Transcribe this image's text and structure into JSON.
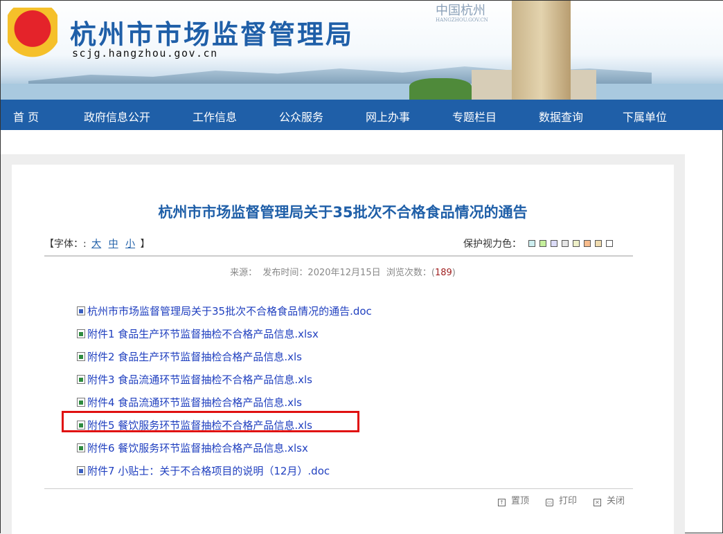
{
  "header": {
    "title": "杭州市市场监督管理局",
    "url": "scjg.hangzhou.gov.cn",
    "partner_logo": "中国杭州",
    "partner_url": "HANGZHOU.GOV.CN"
  },
  "nav": [
    "首 页",
    "政府信息公开",
    "工作信息",
    "公众服务",
    "网上办事",
    "专题栏目",
    "数据查询",
    "下属单位"
  ],
  "article": {
    "title": "杭州市市场监督管理局关于35批次不合格食品情况的通告",
    "font_label_open": "【字体：:",
    "font_sizes": [
      "大",
      "中",
      "小"
    ],
    "font_label_close": "】",
    "eye_label": "保护视力色：",
    "eye_colors": [
      "#cdeef0",
      "#c6f09c",
      "#dcdcf8",
      "#e6e6e6",
      "#eef0c8",
      "#f8bc8c",
      "#f0dcb0",
      "#ffffff"
    ],
    "meta_prefix": "来源：  发布时间：2020年12月15日  浏览次数：(",
    "views": "189",
    "meta_suffix": ")",
    "files": [
      {
        "name": "杭州市市场监督管理局关于35批次不合格食品情况的通告.doc",
        "type": "doc"
      },
      {
        "name": "附件1 食品生产环节监督抽检不合格产品信息.xlsx",
        "type": "xls"
      },
      {
        "name": "附件2 食品生产环节监督抽检合格产品信息.xls",
        "type": "xls"
      },
      {
        "name": "附件3 食品流通环节监督抽检不合格产品信息.xls",
        "type": "xls"
      },
      {
        "name": "附件4 食品流通环节监督抽检合格产品信息.xls",
        "type": "xls"
      },
      {
        "name": "附件5 餐饮服务环节监督抽检不合格产品信息.xls",
        "type": "xls"
      },
      {
        "name": "附件6 餐饮服务环节监督抽检合格产品信息.xlsx",
        "type": "xls"
      },
      {
        "name": "附件7 小贴士：关于不合格项目的说明（12月）.doc",
        "type": "doc"
      }
    ],
    "tools": {
      "top": "置顶",
      "print": "打印",
      "close": "关闭"
    }
  }
}
